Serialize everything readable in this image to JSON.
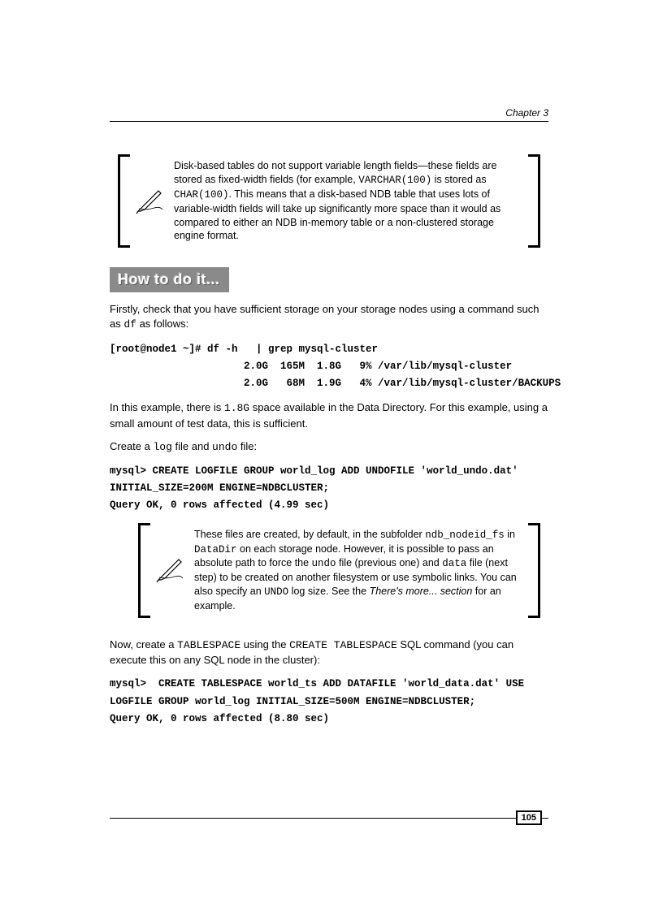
{
  "header": {
    "chapter": "Chapter 3"
  },
  "note1": {
    "t1": "Disk-based tables do not support variable length fields—these fields are stored as fixed-width fields (for example, ",
    "c1": "VARCHAR(100)",
    "t2": " is stored as ",
    "c2": "CHAR(100)",
    "t3": ". This means that a disk-based NDB table that uses lots of variable-width fields will take up significantly more space than it would as compared to either an NDB in-memory table or a non-clustered storage engine format."
  },
  "heading": "How to do it...",
  "p1a": "Firstly, check that you have sufficient storage on your storage nodes using a command such as ",
  "p1c": "df",
  "p1b": " as follows:",
  "code1": "[root@node1 ~]# df -h   | grep mysql-cluster\n                      2.0G  165M  1.8G   9% /var/lib/mysql-cluster\n                      2.0G   68M  1.9G   4% /var/lib/mysql-cluster/BACKUPS",
  "p2a": "In this example, there is ",
  "p2c": "1.8G",
  "p2b": " space available in the Data Directory. For this example, using a small amount of test data, this is sufficient.",
  "p3a": "Create a ",
  "p3c1": "log",
  "p3b": " file and ",
  "p3c2": "undo",
  "p3d": " file:",
  "code2": "mysql> CREATE LOGFILE GROUP world_log ADD UNDOFILE 'world_undo.dat' INITIAL_SIZE=200M ENGINE=NDBCLUSTER;\nQuery OK, 0 rows affected (4.99 sec)",
  "note2": {
    "t1": "These files are created, by default, in the subfolder ",
    "c1": "ndb_nodeid_fs",
    "t2": " in ",
    "c2": "DataDir",
    "t3": " on each storage node. However, it is possible to pass an absolute path to force the ",
    "c3": "undo",
    "t4": " file (previous one) and ",
    "c4": "data",
    "t5": " file (next step) to be created on another filesystem or use symbolic links. You can also specify an ",
    "c5": "UNDO",
    "t6": " log size. See the ",
    "i1": "There's more... section",
    "t7": " for an example."
  },
  "p4a": "Now, create a ",
  "p4c1": "TABLESPACE",
  "p4b": " using the ",
  "p4c2": "CREATE TABLESPACE",
  "p4d": " SQL command (you can execute this on any SQL node in the cluster):",
  "code3": "mysql>  CREATE TABLESPACE world_ts ADD DATAFILE 'world_data.dat' USE LOGFILE GROUP world_log INITIAL_SIZE=500M ENGINE=NDBCLUSTER;\nQuery OK, 0 rows affected (8.80 sec)",
  "footer": {
    "page": "105"
  }
}
